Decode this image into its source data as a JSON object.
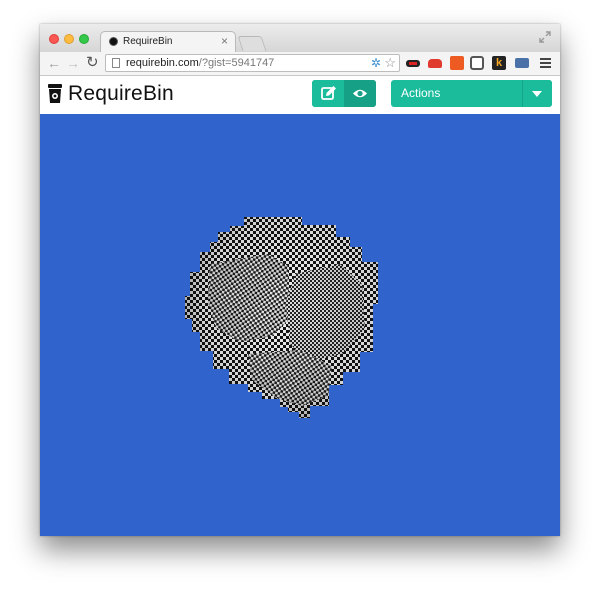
{
  "browser": {
    "tab_title": "RequireBin",
    "tab_close": "×",
    "url_host": "requirebin.com",
    "url_path": "/?gist=5941747",
    "extension_k_label": "k"
  },
  "app": {
    "logo_text": "RequireBin",
    "actions_label": "Actions",
    "accent_color": "#1abc9c",
    "accent_dark_color": "#16a085",
    "canvas_background": "#3063cc"
  }
}
